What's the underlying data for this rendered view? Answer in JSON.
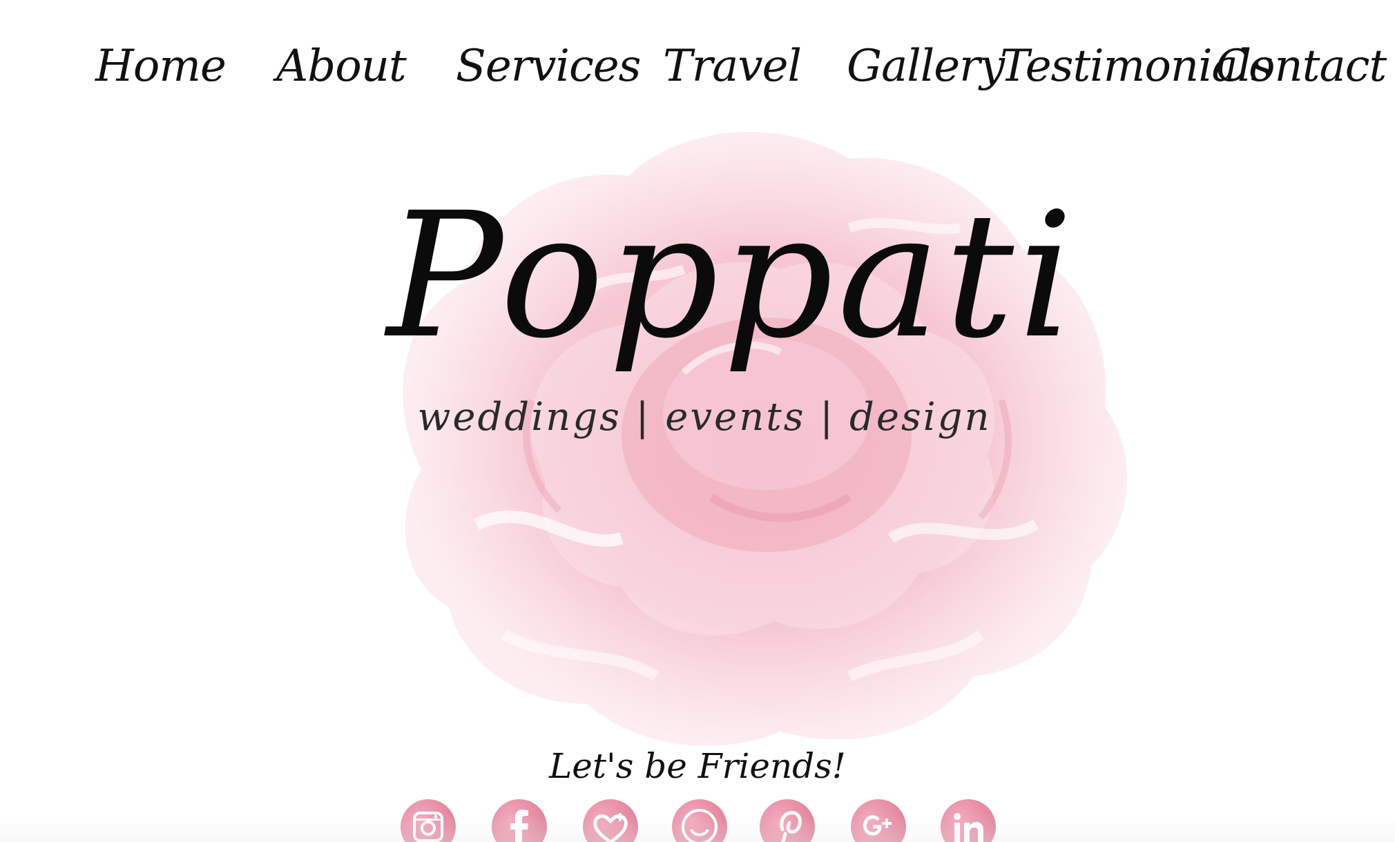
{
  "nav": {
    "home": "Home",
    "about": "About",
    "services": "Services",
    "travel": "Travel",
    "gallery": "Gallery",
    "testimonials": "Testimonials",
    "contact": "Contact"
  },
  "logo": {
    "title": "Poppati",
    "tagline": "weddings | events | design"
  },
  "friends": {
    "label": "Let's be Friends!"
  },
  "social": [
    {
      "icon": "instagram-icon"
    },
    {
      "icon": "facebook-icon"
    },
    {
      "icon": "bloglovin-icon"
    },
    {
      "icon": "smile-icon"
    },
    {
      "icon": "pinterest-icon"
    },
    {
      "icon": "google-plus-icon"
    },
    {
      "icon": "linkedin-icon"
    }
  ],
  "colors": {
    "text": "#111111",
    "peony": "#f3b8c6",
    "icon": "#e58aa2",
    "background": "#ffffff"
  }
}
